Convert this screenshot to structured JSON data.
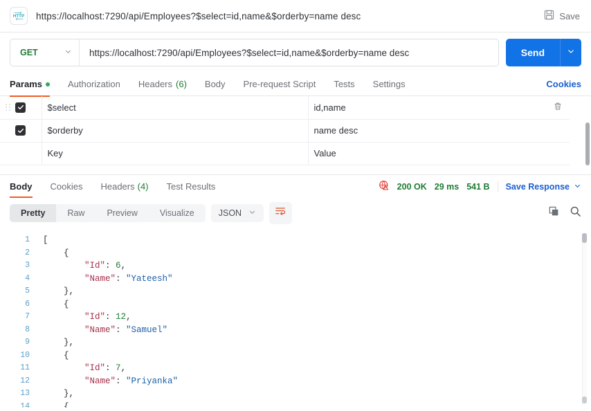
{
  "titlebar": {
    "protocol_icon": "http-icon",
    "request_title": "https://localhost:7290/api/Employees?$select=id,name&$orderby=name desc",
    "save_label": "Save",
    "save_icon": "floppy-disk-icon"
  },
  "request": {
    "method": "GET",
    "method_caret_icon": "chevron-down-icon",
    "url": "https://localhost:7290/api/Employees?$select=id,name&$orderby=name desc",
    "send_label": "Send",
    "send_caret_icon": "chevron-down-icon",
    "send_color": "#1273e6"
  },
  "request_tabs": {
    "items": [
      {
        "label": "Params",
        "badge": "",
        "has_dot": true,
        "active": true
      },
      {
        "label": "Authorization",
        "badge": "",
        "has_dot": false,
        "active": false
      },
      {
        "label": "Headers",
        "badge": "(6)",
        "has_dot": false,
        "active": false
      },
      {
        "label": "Body",
        "badge": "",
        "has_dot": false,
        "active": false
      },
      {
        "label": "Pre-request Script",
        "badge": "",
        "has_dot": false,
        "active": false
      },
      {
        "label": "Tests",
        "badge": "",
        "has_dot": false,
        "active": false
      },
      {
        "label": "Settings",
        "badge": "",
        "has_dot": false,
        "active": false
      }
    ],
    "cookies_link": "Cookies",
    "active_underline_color": "#ef5b25"
  },
  "params_table": {
    "headers": {
      "key": "Key",
      "value": "Value"
    },
    "rows": [
      {
        "checked": true,
        "key": "$select",
        "value": "id,name",
        "has_handle": true,
        "has_delete": true
      },
      {
        "checked": true,
        "key": "$orderby",
        "value": "name desc",
        "has_handle": false,
        "has_delete": false
      }
    ],
    "empty_row": {
      "key_placeholder": "Key",
      "value_placeholder": "Value"
    },
    "delete_icon": "trash-icon",
    "drag_icon": "drag-handle-icon"
  },
  "response_tabs": {
    "items": [
      {
        "label": "Body",
        "badge": "",
        "active": true
      },
      {
        "label": "Cookies",
        "badge": "",
        "active": false
      },
      {
        "label": "Headers",
        "badge": "(4)",
        "active": false
      },
      {
        "label": "Test Results",
        "badge": "",
        "active": false
      }
    ],
    "meta": {
      "warning_icon": "globe-warning-icon",
      "status": "200 OK",
      "time": "29 ms",
      "size": "541 B",
      "save_response_label": "Save Response",
      "save_response_caret_icon": "chevron-down-icon"
    }
  },
  "response_toolbar": {
    "view_modes": [
      {
        "label": "Pretty",
        "active": true
      },
      {
        "label": "Raw",
        "active": false
      },
      {
        "label": "Preview",
        "active": false
      },
      {
        "label": "Visualize",
        "active": false
      }
    ],
    "format": "JSON",
    "format_caret_icon": "chevron-down-icon",
    "wrap_icon": "wrap-lines-icon",
    "copy_icon": "copy-icon",
    "search_icon": "search-icon"
  },
  "response_body": {
    "lines": [
      {
        "n": "1",
        "tokens": [
          {
            "t": "[",
            "c": "punc"
          }
        ],
        "indent": 0
      },
      {
        "n": "2",
        "tokens": [
          {
            "t": "{",
            "c": "punc"
          }
        ],
        "indent": 1
      },
      {
        "n": "3",
        "tokens": [
          {
            "t": "\"Id\"",
            "c": "key"
          },
          {
            "t": ": ",
            "c": "punc"
          },
          {
            "t": "6",
            "c": "num"
          },
          {
            "t": ",",
            "c": "punc"
          }
        ],
        "indent": 2
      },
      {
        "n": "4",
        "tokens": [
          {
            "t": "\"Name\"",
            "c": "key"
          },
          {
            "t": ": ",
            "c": "punc"
          },
          {
            "t": "\"Yateesh\"",
            "c": "str"
          }
        ],
        "indent": 2
      },
      {
        "n": "5",
        "tokens": [
          {
            "t": "},",
            "c": "punc"
          }
        ],
        "indent": 1
      },
      {
        "n": "6",
        "tokens": [
          {
            "t": "{",
            "c": "punc"
          }
        ],
        "indent": 1
      },
      {
        "n": "7",
        "tokens": [
          {
            "t": "\"Id\"",
            "c": "key"
          },
          {
            "t": ": ",
            "c": "punc"
          },
          {
            "t": "12",
            "c": "num"
          },
          {
            "t": ",",
            "c": "punc"
          }
        ],
        "indent": 2
      },
      {
        "n": "8",
        "tokens": [
          {
            "t": "\"Name\"",
            "c": "key"
          },
          {
            "t": ": ",
            "c": "punc"
          },
          {
            "t": "\"Samuel\"",
            "c": "str"
          }
        ],
        "indent": 2
      },
      {
        "n": "9",
        "tokens": [
          {
            "t": "},",
            "c": "punc"
          }
        ],
        "indent": 1
      },
      {
        "n": "10",
        "tokens": [
          {
            "t": "{",
            "c": "punc"
          }
        ],
        "indent": 1
      },
      {
        "n": "11",
        "tokens": [
          {
            "t": "\"Id\"",
            "c": "key"
          },
          {
            "t": ": ",
            "c": "punc"
          },
          {
            "t": "7",
            "c": "num"
          },
          {
            "t": ",",
            "c": "punc"
          }
        ],
        "indent": 2
      },
      {
        "n": "12",
        "tokens": [
          {
            "t": "\"Name\"",
            "c": "key"
          },
          {
            "t": ": ",
            "c": "punc"
          },
          {
            "t": "\"Priyanka\"",
            "c": "str"
          }
        ],
        "indent": 2
      },
      {
        "n": "13",
        "tokens": [
          {
            "t": "},",
            "c": "punc"
          }
        ],
        "indent": 1
      },
      {
        "n": "14",
        "tokens": [
          {
            "t": "{",
            "c": "punc"
          }
        ],
        "indent": 1
      }
    ]
  }
}
